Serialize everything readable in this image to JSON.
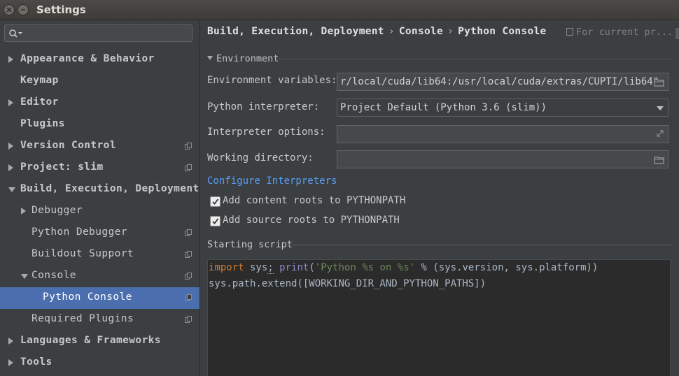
{
  "window": {
    "title": "Settings"
  },
  "search": {
    "placeholder": ""
  },
  "tree": [
    {
      "label": "Appearance & Behavior",
      "indent": 0,
      "arrow": "right",
      "copy": false,
      "selected": false
    },
    {
      "label": "Keymap",
      "indent": 0,
      "arrow": "none",
      "copy": false,
      "selected": false
    },
    {
      "label": "Editor",
      "indent": 0,
      "arrow": "right",
      "copy": false,
      "selected": false
    },
    {
      "label": "Plugins",
      "indent": 0,
      "arrow": "none",
      "copy": false,
      "selected": false
    },
    {
      "label": "Version Control",
      "indent": 0,
      "arrow": "right",
      "copy": true,
      "selected": false
    },
    {
      "label": "Project: slim",
      "indent": 0,
      "arrow": "right",
      "copy": true,
      "selected": false
    },
    {
      "label": "Build, Execution, Deployment",
      "indent": 0,
      "arrow": "down",
      "copy": false,
      "selected": false
    },
    {
      "label": "Debugger",
      "indent": 1,
      "arrow": "right",
      "copy": false,
      "selected": false
    },
    {
      "label": "Python Debugger",
      "indent": 1,
      "arrow": "none",
      "copy": true,
      "selected": false
    },
    {
      "label": "Buildout Support",
      "indent": 1,
      "arrow": "none",
      "copy": true,
      "selected": false
    },
    {
      "label": "Console",
      "indent": 1,
      "arrow": "down",
      "copy": true,
      "selected": false
    },
    {
      "label": "Python Console",
      "indent": 2,
      "arrow": "none",
      "copy": true,
      "selected": true
    },
    {
      "label": "Required Plugins",
      "indent": 1,
      "arrow": "none",
      "copy": true,
      "selected": false
    },
    {
      "label": "Languages & Frameworks",
      "indent": 0,
      "arrow": "right",
      "copy": false,
      "selected": false
    },
    {
      "label": "Tools",
      "indent": 0,
      "arrow": "right",
      "copy": false,
      "selected": false
    }
  ],
  "breadcrumb": [
    "Build, Execution, Deployment",
    "Console",
    "Python Console"
  ],
  "breadcrumb_sep": "›",
  "for_current": "For current pr...",
  "environment": {
    "header": "Environment",
    "env_vars_label": "Environment variables:",
    "env_vars_value": "r/local/cuda/lib64:/usr/local/cuda/extras/CUPTI/lib64\"",
    "interpreter_label": "Python interpreter:",
    "interpreter_value": "Project Default (Python 3.6 (slim))",
    "interpreter_options_label": "Interpreter options:",
    "interpreter_options_value": "",
    "working_dir_label": "Working directory:",
    "working_dir_value": ""
  },
  "configure_link": "Configure Interpreters",
  "checkboxes": [
    {
      "label": "Add content roots to PYTHONPATH",
      "checked": true
    },
    {
      "label": "Add source roots to PYTHONPATH",
      "checked": true
    }
  ],
  "starting_script": {
    "header": "Starting script",
    "line1": {
      "kw": "import",
      "mod": " sys",
      "semi": ";",
      "sp": " ",
      "fn": "print",
      "paren": "(",
      "str": "'Python %s on %s'",
      "rest": " % (sys.version, sys.platform))"
    },
    "line2": "sys.path.extend([WORKING_DIR_AND_PYTHON_PATHS])"
  },
  "colors": {
    "selection": "#4b6eaf",
    "link": "#589df6",
    "keyword": "#cc7832",
    "string": "#6a8759"
  }
}
